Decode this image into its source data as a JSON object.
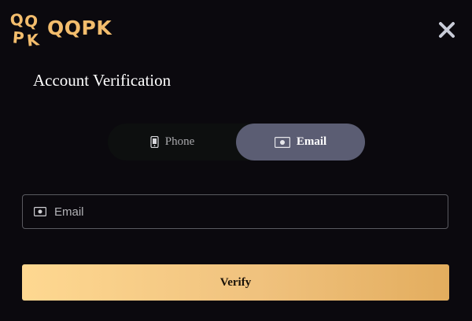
{
  "brand": {
    "logo_mark": "QQPK",
    "name": "QQPK",
    "accent": "#f3bd6d"
  },
  "dialog": {
    "title": "Account Verification",
    "close_icon": "close-icon"
  },
  "tabs": [
    {
      "label": "Phone",
      "icon": "phone-icon",
      "active": false
    },
    {
      "label": "Email",
      "icon": "email-icon",
      "active": true
    }
  ],
  "email_field": {
    "icon": "email-icon",
    "value": "",
    "placeholder": "Email"
  },
  "verify": {
    "label": "Verify"
  },
  "colors": {
    "background": "#0b090e",
    "active_tab": "#5b5d73",
    "button_gradient_start": "#fed891",
    "button_gradient_end": "#e3ad5e"
  }
}
